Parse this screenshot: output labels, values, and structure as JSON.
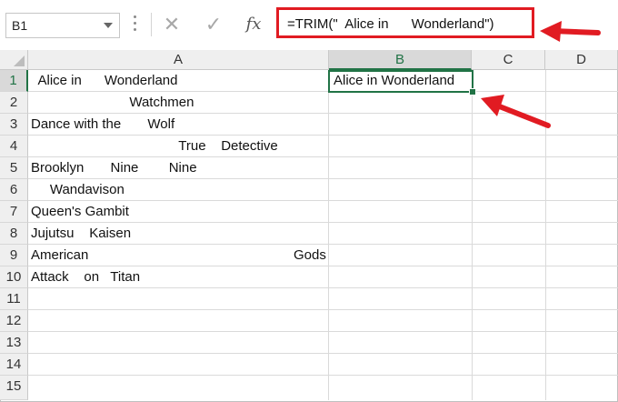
{
  "name_box": {
    "value": "B1"
  },
  "formula_bar": {
    "formula": "=TRIM(\"  Alice in      Wonderland\")"
  },
  "columns": [
    "A",
    "B",
    "C",
    "D"
  ],
  "rows": [
    "1",
    "2",
    "3",
    "4",
    "5",
    "6",
    "7",
    "8",
    "9",
    "10",
    "11",
    "12",
    "13",
    "14",
    "15"
  ],
  "cells": {
    "A1": "  Alice in      Wonderland",
    "A2": "                          Watchmen",
    "A3": "Dance with the       Wolf",
    "A4": "                                       True    Detective",
    "A5": "Brooklyn       Nine        Nine",
    "A6": "     Wandavison",
    "A7": "Queen's Gambit",
    "A8": "Jujutsu    Kaisen",
    "A9": "American",
    "A9_right": "Gods",
    "A10": "Attack    on   Titan",
    "B1": "Alice in Wonderland"
  },
  "selected_cell": "B1",
  "annotation_color": "#e11b22",
  "selection_color": "#217346"
}
